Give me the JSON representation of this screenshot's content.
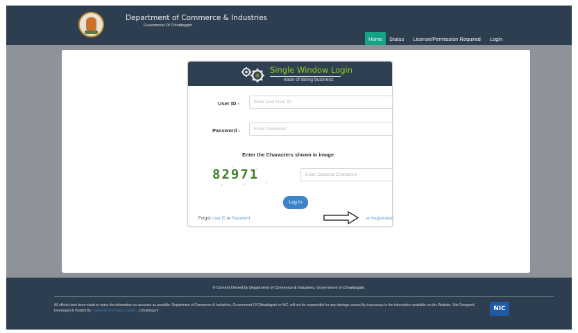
{
  "header": {
    "title": "Department of Commerce & Industries",
    "subtitle": "Government Of Chhattisgarh",
    "nav": [
      {
        "label": "Home",
        "active": true
      },
      {
        "label": "Status",
        "active": false
      },
      {
        "label": "License/Permission Required",
        "active": false
      },
      {
        "label": "Login",
        "active": false
      }
    ]
  },
  "login": {
    "title": "Single Window Login",
    "tagline": "ease of doing business",
    "user_id_label": "User ID -",
    "user_id_placeholder": "Enter your User ID",
    "password_label": "Password -",
    "password_placeholder": "Enter Password",
    "captcha_caption": "Enter the Characters shown in image",
    "captcha_value": "82971",
    "captcha_placeholder": "Enter Captcha Characters",
    "login_button": "Log In",
    "forgot_prefix": "Forgot ",
    "forgot_user_id": "User ID",
    "forgot_or": " or ",
    "forgot_password": "Password",
    "registration_link": "er Registration"
  },
  "footer": {
    "owned_text": "© Content Owned by Department of Commerce & Industries, Government of Chhattisgarh.",
    "disclaimer": "All efforts have been made to make the information as accurate as possible. Department of Commerce & Industries, Government Of Chhattisgarh or NIC, will not be responsible for any damage caused by inaccuracy in the information available on this Website. Site Designed, Developed & Hosted By : ",
    "nic_link": "National Informatics Center",
    "disclaimer_end": " , Chhattisgarh",
    "nic_logo_text": "NIC"
  },
  "colors": {
    "header_bg": "#2d3e50",
    "nav_active": "#15a386",
    "login_title": "#8fd21e",
    "button": "#3a84c9",
    "link": "#5b9bd5"
  },
  "icons": [
    "emblem-icon",
    "gear-icon",
    "arrow-icon"
  ]
}
